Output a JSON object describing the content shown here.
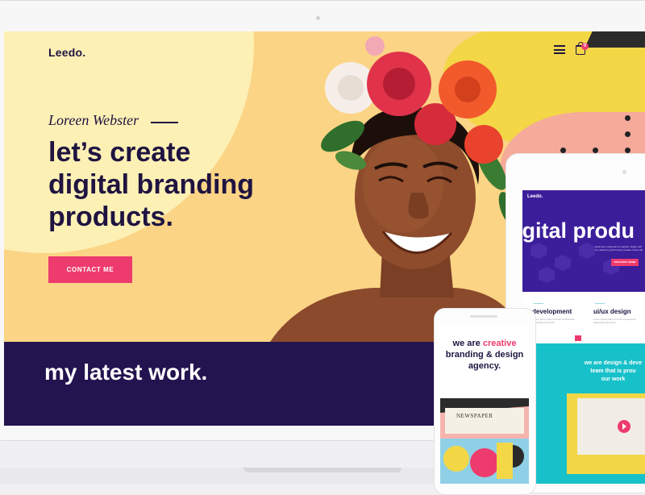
{
  "site": {
    "brand": "Leedo.",
    "cart_count": "0",
    "signature": "Loreen Webster",
    "headline": [
      "let’s create",
      "digital branding",
      "products."
    ],
    "cta_label": "CONTACT ME",
    "works_title": "my latest work."
  },
  "tablet": {
    "brand": "Leedo.",
    "hero_text": "igital produ",
    "hero_sub": "Quid lorem dignissimos together highly with our gathering sprint being created, these will",
    "button": "DISCOVER THEME",
    "cards": [
      {
        "label": "development",
        "text": "Lorem ipsum dolor sit amet consectetur adipiscing elit sed do"
      },
      {
        "label": "ui/ux design",
        "text": "Lorem ipsum dolor sit amet consectetur adipiscing elit sed do"
      }
    ],
    "cyan_text": [
      "we are design & deve",
      "team that is prou",
      "our work"
    ]
  },
  "phone": {
    "line1_plain": "we are ",
    "line1_accent": "creative",
    "line2": "branding & design",
    "line3": "agency.",
    "art_text": "NEWSPAPER"
  },
  "colors": {
    "accent": "#ee3b6d",
    "navy": "#1f1441",
    "works_bg": "#23134f",
    "hero_bg": "#fbd485",
    "tablet_hero": "#3c1d9a",
    "cyan": "#17c1c9"
  }
}
